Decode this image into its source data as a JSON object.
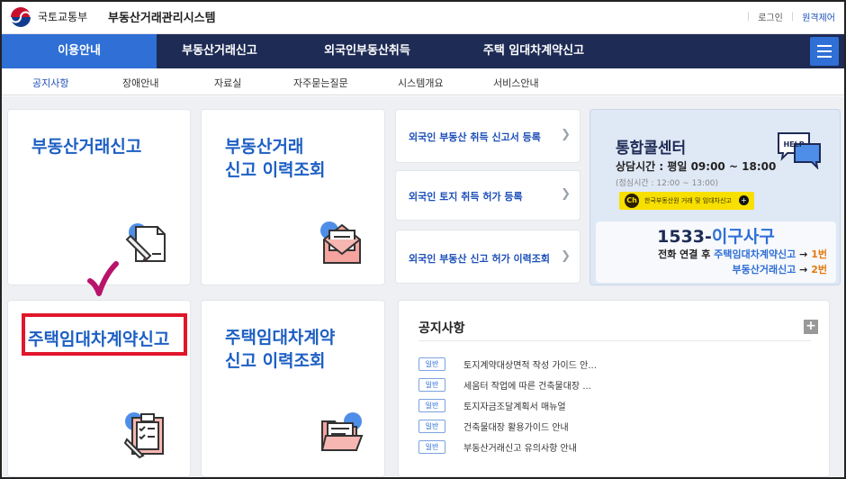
{
  "header": {
    "ministry": "국토교통부",
    "system_title": "부동산거래관리시스템",
    "login": "로그인",
    "remote": "원격제어"
  },
  "main_nav": {
    "items": [
      "이용안내",
      "부동산거래신고",
      "외국인부동산취득",
      "주택 임대차계약신고"
    ],
    "active": "이용안내",
    "menu_icon": "hamburger-menu-icon"
  },
  "sub_nav": {
    "items": [
      "공지사항",
      "장애안내",
      "자료실",
      "자주묻는질문",
      "시스템개요",
      "서비스안내"
    ],
    "active": "공지사항"
  },
  "cards": {
    "report": {
      "title": "부동산거래신고",
      "icon": "document-pen-icon"
    },
    "history": {
      "title": "부동산거래\n신고 이력조회",
      "icon": "mail-envelope-icon"
    },
    "lease": {
      "title": "주택임대차계약신고",
      "icon": "clipboard-checklist-icon"
    },
    "lease_history": {
      "title": "주택임대차계약\n신고 이력조회",
      "icon": "folder-icon"
    }
  },
  "foreign_links": [
    "외국인 부동산 취득 신고서 등록",
    "외국인 토지 취득 허가 등록",
    "외국인 부동산 신고 허가 이력조회"
  ],
  "call_center": {
    "title": "통합콜센터",
    "hours": "상담시간 : 평일 09:00 ~ 18:00",
    "lunch": "(점심시간 : 12:00 ~ 13:00)",
    "kakao_ch": "Ch",
    "kakao_text": "한국부동산원 거래 및 임대차신고",
    "help_label": "HELP",
    "phone_prefix": "1533-",
    "phone_word": "이구사구",
    "line1_prefix": "전화 연결 후",
    "line1_target": "주택임대차계약신고",
    "line1_arrow": "→",
    "line1_num": "1번",
    "line2_target": "부동산거래신고",
    "line2_arrow": "→",
    "line2_num": "2번"
  },
  "notice": {
    "title": "공지사항",
    "more": "+",
    "items": [
      {
        "badge": "일반",
        "text": "토지계약대상면적 작성 가이드 안..."
      },
      {
        "badge": "일반",
        "text": "세움터 작업에 따른 건축물대장 ..."
      },
      {
        "badge": "일반",
        "text": "토지자금조달계획서 매뉴얼"
      },
      {
        "badge": "일반",
        "text": "건축물대장 활용가이드 안내"
      },
      {
        "badge": "일반",
        "text": "부동산거래신고 유의사항 안내"
      }
    ]
  },
  "colors": {
    "nav_bg": "#1e2b55",
    "accent": "#2f6fd6",
    "highlight": "#e0162b",
    "checkmark": "#b8146b"
  }
}
